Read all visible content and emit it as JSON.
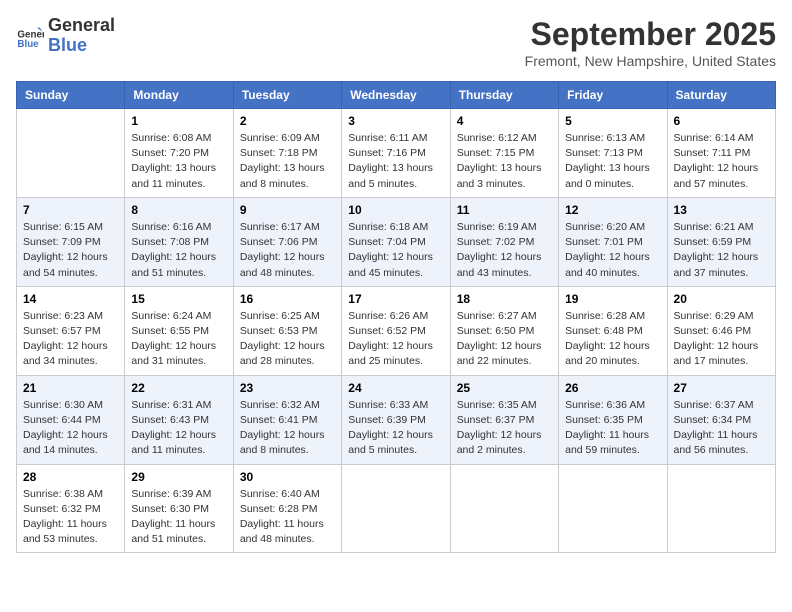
{
  "header": {
    "logo_line1": "General",
    "logo_line2": "Blue",
    "month": "September 2025",
    "location": "Fremont, New Hampshire, United States"
  },
  "weekdays": [
    "Sunday",
    "Monday",
    "Tuesday",
    "Wednesday",
    "Thursday",
    "Friday",
    "Saturday"
  ],
  "weeks": [
    [
      {
        "day": "",
        "info": ""
      },
      {
        "day": "1",
        "info": "Sunrise: 6:08 AM\nSunset: 7:20 PM\nDaylight: 13 hours\nand 11 minutes."
      },
      {
        "day": "2",
        "info": "Sunrise: 6:09 AM\nSunset: 7:18 PM\nDaylight: 13 hours\nand 8 minutes."
      },
      {
        "day": "3",
        "info": "Sunrise: 6:11 AM\nSunset: 7:16 PM\nDaylight: 13 hours\nand 5 minutes."
      },
      {
        "day": "4",
        "info": "Sunrise: 6:12 AM\nSunset: 7:15 PM\nDaylight: 13 hours\nand 3 minutes."
      },
      {
        "day": "5",
        "info": "Sunrise: 6:13 AM\nSunset: 7:13 PM\nDaylight: 13 hours\nand 0 minutes."
      },
      {
        "day": "6",
        "info": "Sunrise: 6:14 AM\nSunset: 7:11 PM\nDaylight: 12 hours\nand 57 minutes."
      }
    ],
    [
      {
        "day": "7",
        "info": "Sunrise: 6:15 AM\nSunset: 7:09 PM\nDaylight: 12 hours\nand 54 minutes."
      },
      {
        "day": "8",
        "info": "Sunrise: 6:16 AM\nSunset: 7:08 PM\nDaylight: 12 hours\nand 51 minutes."
      },
      {
        "day": "9",
        "info": "Sunrise: 6:17 AM\nSunset: 7:06 PM\nDaylight: 12 hours\nand 48 minutes."
      },
      {
        "day": "10",
        "info": "Sunrise: 6:18 AM\nSunset: 7:04 PM\nDaylight: 12 hours\nand 45 minutes."
      },
      {
        "day": "11",
        "info": "Sunrise: 6:19 AM\nSunset: 7:02 PM\nDaylight: 12 hours\nand 43 minutes."
      },
      {
        "day": "12",
        "info": "Sunrise: 6:20 AM\nSunset: 7:01 PM\nDaylight: 12 hours\nand 40 minutes."
      },
      {
        "day": "13",
        "info": "Sunrise: 6:21 AM\nSunset: 6:59 PM\nDaylight: 12 hours\nand 37 minutes."
      }
    ],
    [
      {
        "day": "14",
        "info": "Sunrise: 6:23 AM\nSunset: 6:57 PM\nDaylight: 12 hours\nand 34 minutes."
      },
      {
        "day": "15",
        "info": "Sunrise: 6:24 AM\nSunset: 6:55 PM\nDaylight: 12 hours\nand 31 minutes."
      },
      {
        "day": "16",
        "info": "Sunrise: 6:25 AM\nSunset: 6:53 PM\nDaylight: 12 hours\nand 28 minutes."
      },
      {
        "day": "17",
        "info": "Sunrise: 6:26 AM\nSunset: 6:52 PM\nDaylight: 12 hours\nand 25 minutes."
      },
      {
        "day": "18",
        "info": "Sunrise: 6:27 AM\nSunset: 6:50 PM\nDaylight: 12 hours\nand 22 minutes."
      },
      {
        "day": "19",
        "info": "Sunrise: 6:28 AM\nSunset: 6:48 PM\nDaylight: 12 hours\nand 20 minutes."
      },
      {
        "day": "20",
        "info": "Sunrise: 6:29 AM\nSunset: 6:46 PM\nDaylight: 12 hours\nand 17 minutes."
      }
    ],
    [
      {
        "day": "21",
        "info": "Sunrise: 6:30 AM\nSunset: 6:44 PM\nDaylight: 12 hours\nand 14 minutes."
      },
      {
        "day": "22",
        "info": "Sunrise: 6:31 AM\nSunset: 6:43 PM\nDaylight: 12 hours\nand 11 minutes."
      },
      {
        "day": "23",
        "info": "Sunrise: 6:32 AM\nSunset: 6:41 PM\nDaylight: 12 hours\nand 8 minutes."
      },
      {
        "day": "24",
        "info": "Sunrise: 6:33 AM\nSunset: 6:39 PM\nDaylight: 12 hours\nand 5 minutes."
      },
      {
        "day": "25",
        "info": "Sunrise: 6:35 AM\nSunset: 6:37 PM\nDaylight: 12 hours\nand 2 minutes."
      },
      {
        "day": "26",
        "info": "Sunrise: 6:36 AM\nSunset: 6:35 PM\nDaylight: 11 hours\nand 59 minutes."
      },
      {
        "day": "27",
        "info": "Sunrise: 6:37 AM\nSunset: 6:34 PM\nDaylight: 11 hours\nand 56 minutes."
      }
    ],
    [
      {
        "day": "28",
        "info": "Sunrise: 6:38 AM\nSunset: 6:32 PM\nDaylight: 11 hours\nand 53 minutes."
      },
      {
        "day": "29",
        "info": "Sunrise: 6:39 AM\nSunset: 6:30 PM\nDaylight: 11 hours\nand 51 minutes."
      },
      {
        "day": "30",
        "info": "Sunrise: 6:40 AM\nSunset: 6:28 PM\nDaylight: 11 hours\nand 48 minutes."
      },
      {
        "day": "",
        "info": ""
      },
      {
        "day": "",
        "info": ""
      },
      {
        "day": "",
        "info": ""
      },
      {
        "day": "",
        "info": ""
      }
    ]
  ]
}
